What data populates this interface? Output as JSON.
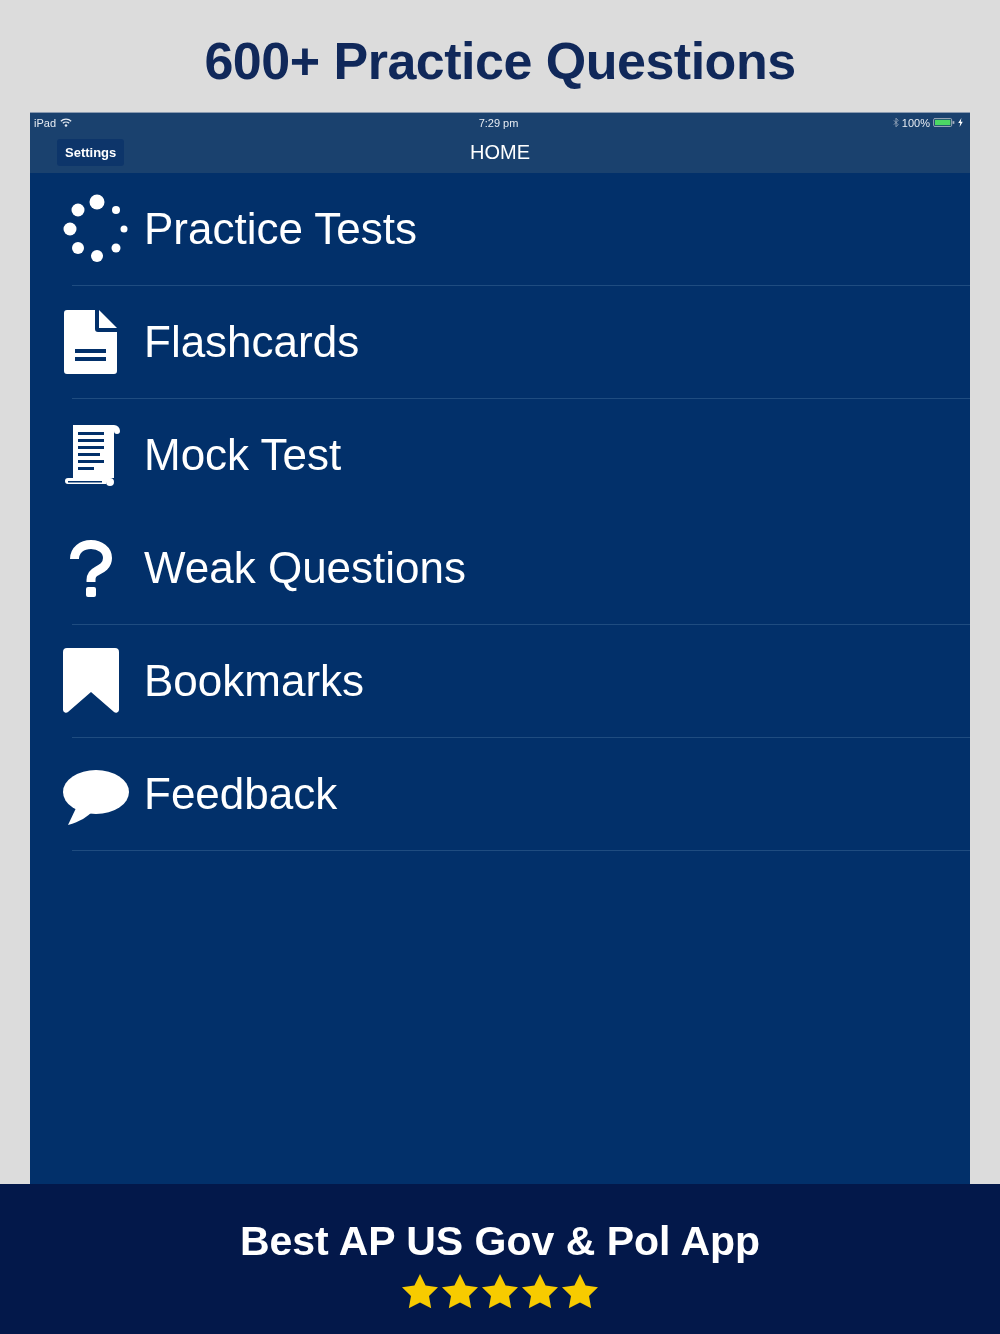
{
  "headline": "600+ Practice Questions",
  "status_bar": {
    "device": "iPad",
    "time": "7:29 pm",
    "battery": "100%"
  },
  "nav_bar": {
    "button": "Settings",
    "title": "HOME"
  },
  "menu": [
    {
      "label": "Practice Tests",
      "divider": true
    },
    {
      "label": "Flashcards",
      "divider": true
    },
    {
      "label": "Mock Test",
      "divider": false
    },
    {
      "label": "Weak Questions",
      "divider": true
    },
    {
      "label": "Bookmarks",
      "divider": true
    },
    {
      "label": "Feedback",
      "divider": true
    }
  ],
  "banner": {
    "title": "Best AP US Gov & Pol App",
    "stars": 5
  }
}
